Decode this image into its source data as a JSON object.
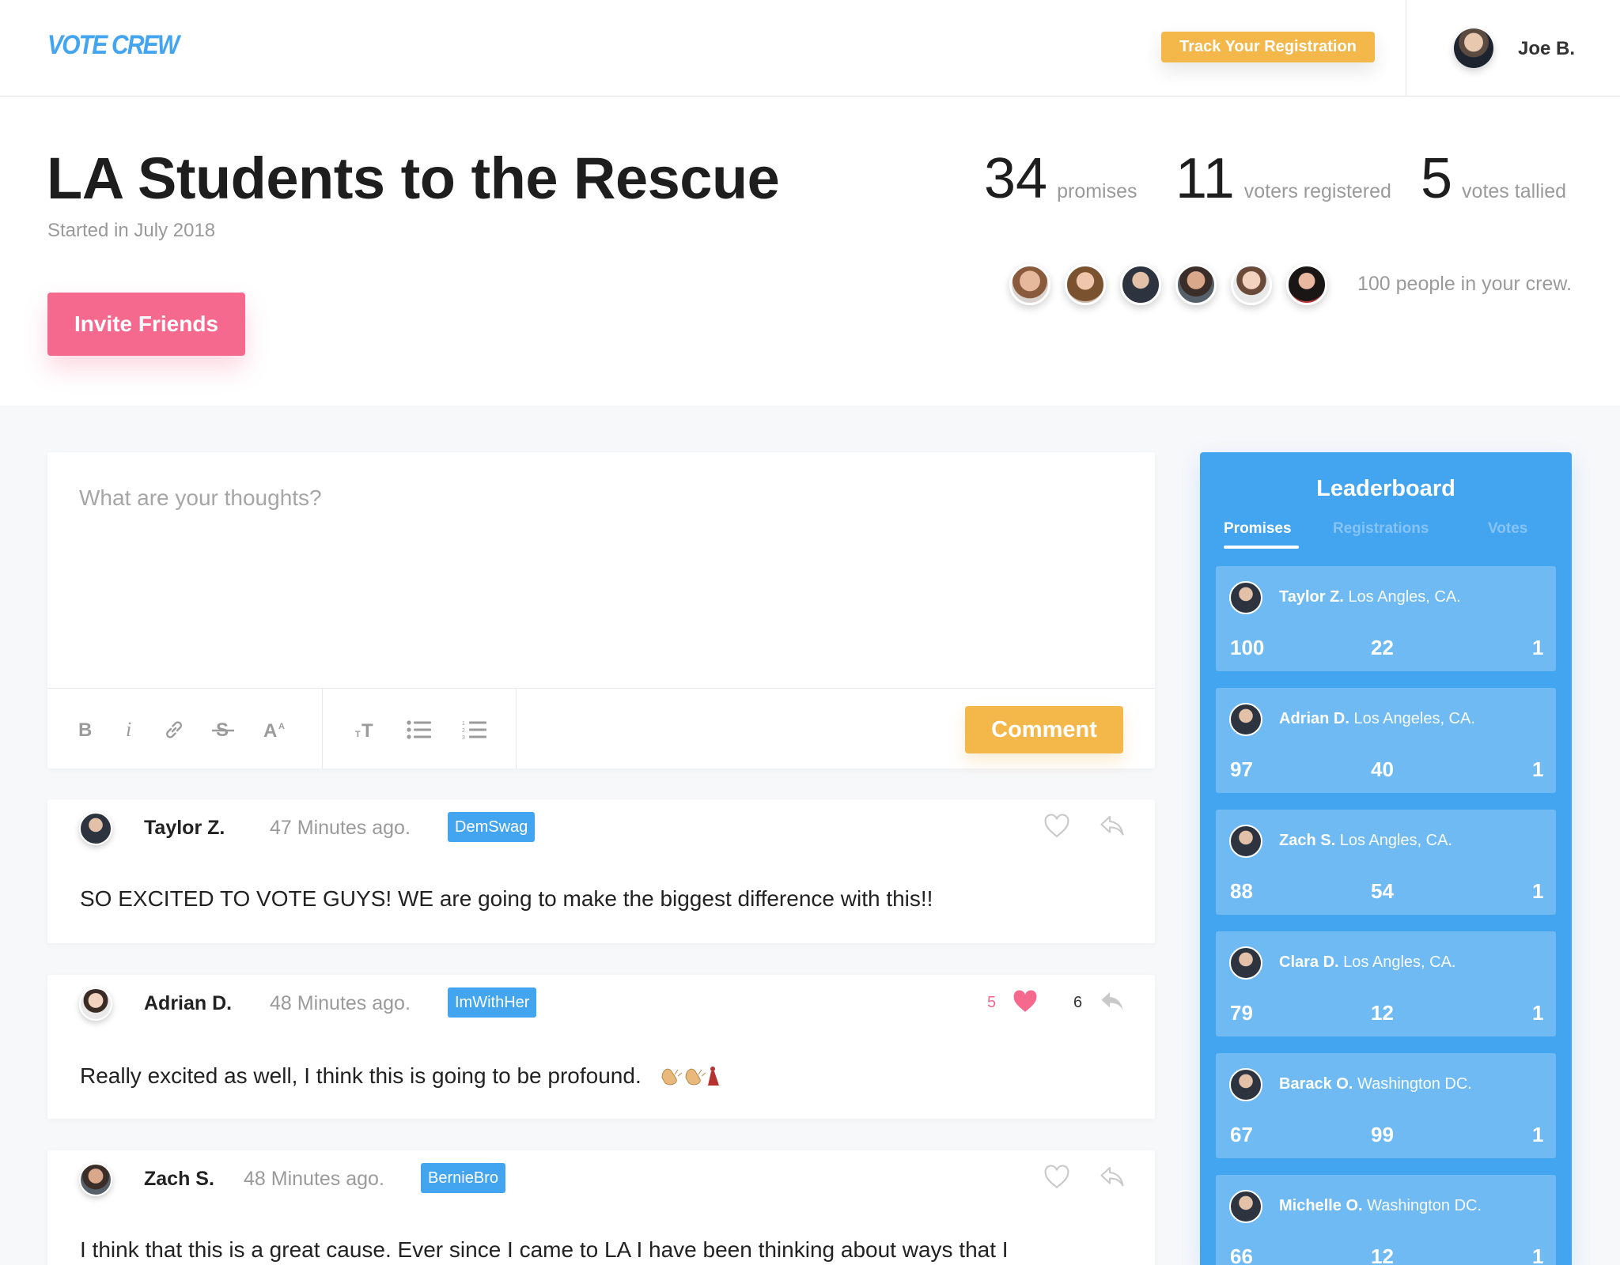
{
  "nav": {
    "logo": "VOTE CREW",
    "track_button": "Track Your Registration",
    "user_name": "Joe B."
  },
  "header": {
    "title": "LA Students to the Rescue",
    "subtitle": "Started in July 2018",
    "invite_button": "Invite Friends",
    "stats": [
      {
        "value": "34",
        "label": "promises"
      },
      {
        "value": "11",
        "label": "voters registered"
      },
      {
        "value": "5",
        "label": "votes tallied"
      }
    ],
    "crew_count": "100 people in your crew."
  },
  "editor": {
    "placeholder": "What are your thoughts?",
    "comment_button": "Comment"
  },
  "comments": [
    {
      "name": "Taylor Z.",
      "time": "47 Minutes ago.",
      "tag": "DemSwag",
      "body": "SO EXCITED TO VOTE GUYS! WE are going to make the biggest difference with this!!",
      "likes": "",
      "replies": "",
      "liked": false
    },
    {
      "name": "Adrian D.",
      "time": "48 Minutes ago.",
      "tag": "ImWithHer",
      "body": "Really excited as well, I think this is going to be profound.",
      "likes": "5",
      "replies": "6",
      "liked": true
    },
    {
      "name": "Zach S.",
      "time": "48 Minutes ago.",
      "tag": "BernieBro",
      "body": "I think that this is a great cause. Ever since I came to LA I have been thinking about ways that I",
      "likes": "",
      "replies": "",
      "liked": false
    }
  ],
  "leaderboard": {
    "title": "Leaderboard",
    "tabs": [
      "Promises",
      "Registrations",
      "Votes"
    ],
    "active_tab": "Promises",
    "entries": [
      {
        "name": "Taylor Z.",
        "location": "Los Angles, CA.",
        "promises": "100",
        "registrations": "22",
        "votes": "1"
      },
      {
        "name": "Adrian D.",
        "location": "Los Angeles, CA.",
        "promises": "97",
        "registrations": "40",
        "votes": "1"
      },
      {
        "name": "Zach S.",
        "location": "Los Angles, CA.",
        "promises": "88",
        "registrations": "54",
        "votes": "1"
      },
      {
        "name": "Clara D.",
        "location": "Los Angles, CA.",
        "promises": "79",
        "registrations": "12",
        "votes": "1"
      },
      {
        "name": "Barack O.",
        "location": "Washington DC.",
        "promises": "67",
        "registrations": "99",
        "votes": "1"
      },
      {
        "name": "Michelle O.",
        "location": "Washington DC.",
        "promises": "66",
        "registrations": "12",
        "votes": "1"
      }
    ]
  },
  "colors": {
    "brand_blue": "#43a4ef",
    "accent_yellow": "#f4b84a",
    "invite_pink": "#f5698f"
  }
}
